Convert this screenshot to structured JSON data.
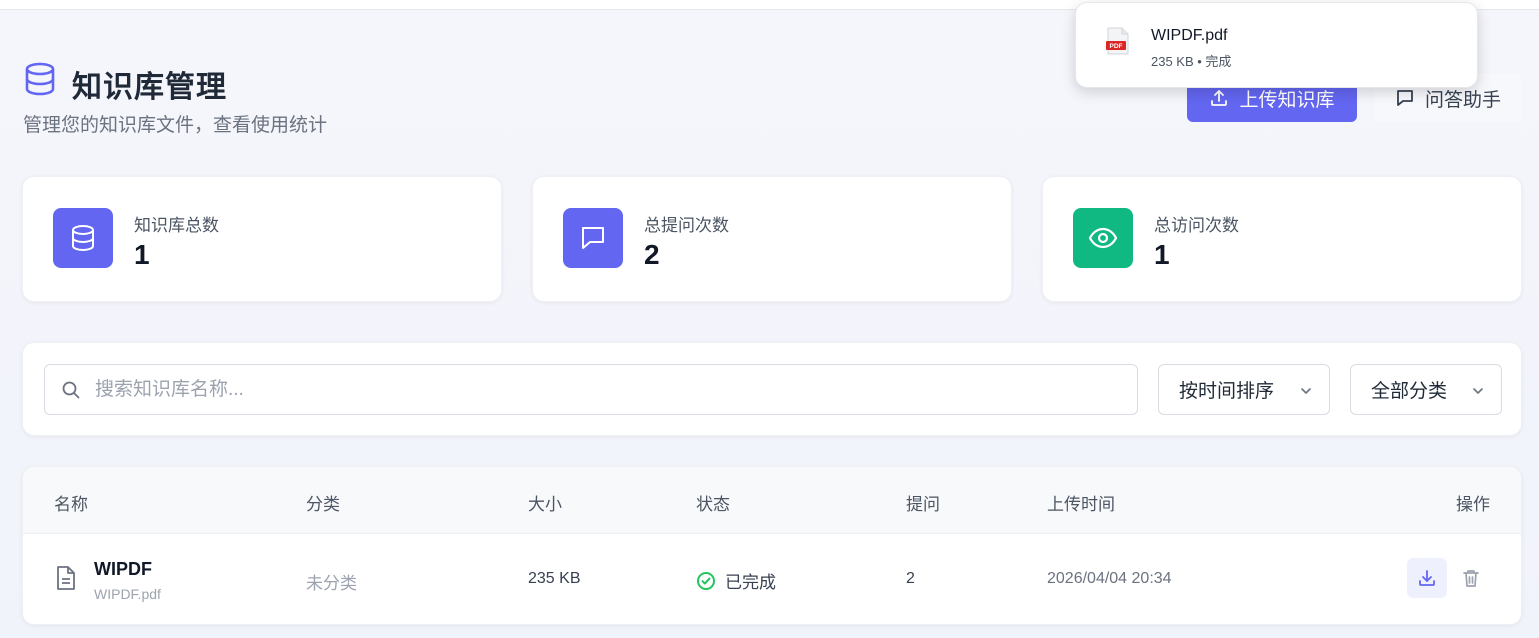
{
  "header": {
    "title": "知识库管理",
    "subtitle": "管理您的知识库文件，查看使用统计",
    "upload_label": "上传知识库",
    "qa_label": "问答助手",
    "icon": "database-icon"
  },
  "toast": {
    "file_name": "WIPDF.pdf",
    "meta": "235 KB • 完成",
    "icon": "pdf-file-icon"
  },
  "stats": [
    {
      "label": "知识库总数",
      "value": "1",
      "icon": "database-icon",
      "color": "#6366f1"
    },
    {
      "label": "总提问次数",
      "value": "2",
      "icon": "chat-icon",
      "color": "#6366f1"
    },
    {
      "label": "总访问次数",
      "value": "1",
      "icon": "eye-icon",
      "color": "#10b981"
    }
  ],
  "filters": {
    "search_placeholder": "搜索知识库名称...",
    "sort_label": "按时间排序",
    "category_label": "全部分类"
  },
  "table": {
    "columns": [
      "名称",
      "分类",
      "大小",
      "状态",
      "提问",
      "上传时间",
      "操作"
    ],
    "rows": [
      {
        "name": "WIPDF",
        "file": "WIPDF.pdf",
        "category": "未分类",
        "size": "235 KB",
        "status": "已完成",
        "questions": "2",
        "uploaded": "2026/04/04 20:34"
      }
    ]
  },
  "colors": {
    "accent": "#6366f1",
    "success": "#10b981",
    "status_ok": "#22c55e"
  }
}
